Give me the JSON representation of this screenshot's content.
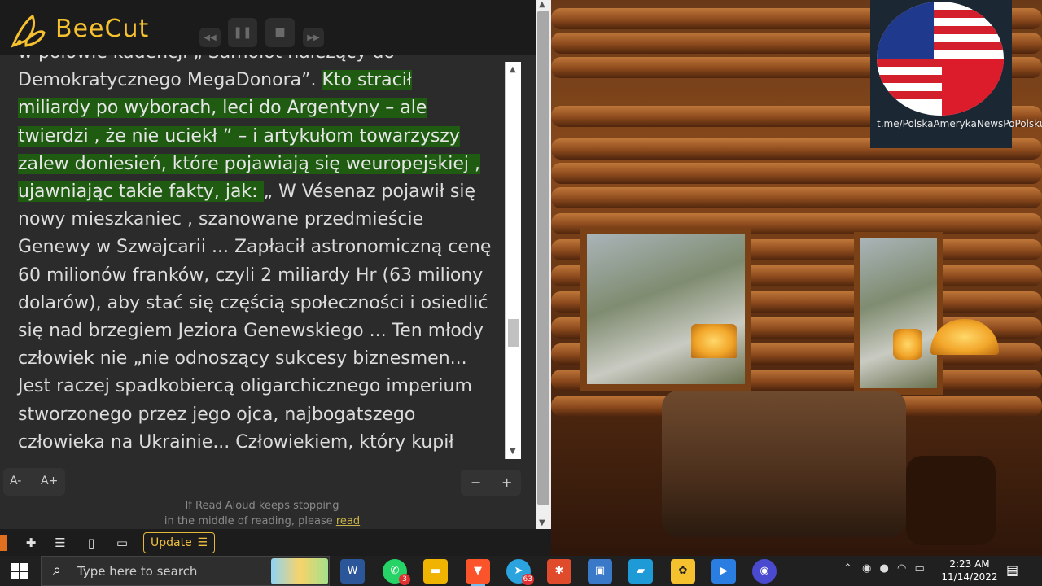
{
  "app": {
    "name": "BeeCut"
  },
  "player": {
    "rewind_icon": "rewind-icon",
    "pause_icon": "pause-icon",
    "stop_icon": "stop-icon",
    "forward_icon": "fast-forward-icon"
  },
  "reader": {
    "line_0": "w połowie kadencji  „  Samolot należący do",
    "line_1_pre": "Demokratycznego MegaDonora”. ",
    "line_1_hl": "Kto stracił",
    "line_2_hl": "miliardy po wyborach, leci do Argentyny – ale",
    "line_3_hl": "twierdzi , że nie uciekł ” – i artykułom towarzyszy",
    "line_4_hl": "zalew doniesień, które pojawiają się weuropejskiej ,",
    "line_5_hl": "ujawniając takie fakty, jak: ",
    "line_5_post": "„ W Vésenaz pojawił się",
    "line_6": "nowy mieszkaniec , szanowane przedmieście",
    "line_7": "Genewy w Szwajcarii ... Zapłacił astronomiczną cenę",
    "line_8": "60 milionów franków, czyli 2 miliardy Hr (63 miliony",
    "line_9": "dolarów), aby stać się częścią społeczności i osiedlić",
    "line_10": "się nad brzegiem Jeziora Genewskiego ... Ten młody",
    "line_11": "człowiek nie „nie odnoszący sukcesy biznesmen...",
    "line_12": "Jest raczej spadkobiercą oligarchicznego imperium",
    "line_13": "stworzonego przez jego ojca, najbogatszego",
    "line_14": "człowieka na Ukrainie... Człowiekiem, który kupił",
    "font_decrease": "A-",
    "font_increase": "A+",
    "speed_decrease": "−",
    "speed_increase": "+",
    "notice_line1": "If Read Aloud keeps stopping",
    "notice_line2": "in the middle of reading, please ",
    "notice_link": "read"
  },
  "browser_bar": {
    "update_label": "Update",
    "update_menu": "☰"
  },
  "telegram": {
    "url": "t.me/PolskaAmerykaNewsPoPolsku"
  },
  "taskbar": {
    "search_placeholder": "Type here to search",
    "telegram_badge": "63",
    "whatsapp_badge": "3",
    "time": "2:23 AM",
    "date": "11/14/2022"
  }
}
